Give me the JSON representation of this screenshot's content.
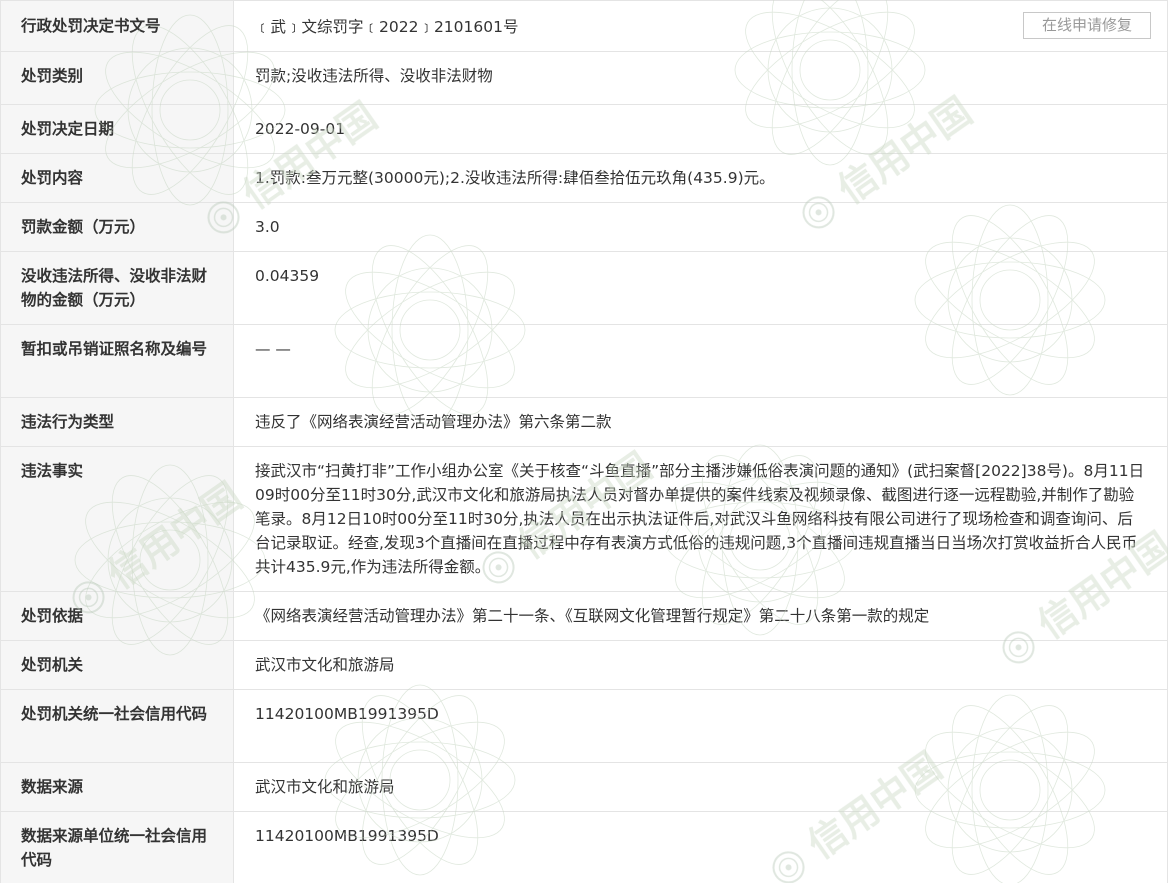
{
  "buttons": {
    "repair": "在线申请修复"
  },
  "rows": [
    {
      "label": "行政处罚决定书文号",
      "value": "﹝武﹞文综罚字﹝2022﹞2101601号"
    },
    {
      "label": "处罚类别",
      "value": "罚款;没收违法所得、没收非法财物"
    },
    {
      "label": "处罚决定日期",
      "value": "2022-09-01"
    },
    {
      "label": "处罚内容",
      "value": "1.罚款:叁万元整(30000元);2.没收违法所得:肆佰叁拾伍元玖角(435.9)元。"
    },
    {
      "label": "罚款金额（万元）",
      "value": "3.0"
    },
    {
      "label": "没收违法所得、没收非法财物的金额（万元）",
      "value": "0.04359"
    },
    {
      "label": "暂扣或吊销证照名称及编号",
      "value": "— —"
    },
    {
      "label": "违法行为类型",
      "value": "违反了《网络表演经营活动管理办法》第六条第二款"
    },
    {
      "label": "违法事实",
      "value": "接武汉市“扫黄打非”工作小组办公室《关于核查“斗鱼直播”部分主播涉嫌低俗表演问题的通知》(武扫案督[2022]38号)。8月11日09时00分至11时30分,武汉市文化和旅游局执法人员对督办单提供的案件线索及视频录像、截图进行逐一远程勘验,并制作了勘验笔录。8月12日10时00分至11时30分,执法人员在出示执法证件后,对武汉斗鱼网络科技有限公司进行了现场检查和调查询问、后台记录取证。经查,发现3个直播间在直播过程中存有表演方式低俗的违规问题,3个直播间违规直播当日当场次打赏收益折合人民币共计435.9元,作为违法所得金额。"
    },
    {
      "label": "处罚依据",
      "value": "《网络表演经营活动管理办法》第二十一条、《互联网文化管理暂行规定》第二十八条第一款的规定"
    },
    {
      "label": "处罚机关",
      "value": "武汉市文化和旅游局"
    },
    {
      "label": "处罚机关统一社会信用代码",
      "value": "11420100MB1991395D"
    },
    {
      "label": "数据来源",
      "value": "武汉市文化和旅游局"
    },
    {
      "label": "数据来源单位统一社会信用代码",
      "value": "11420100MB1991395D"
    }
  ],
  "watermark": {
    "text": "信用中国"
  }
}
